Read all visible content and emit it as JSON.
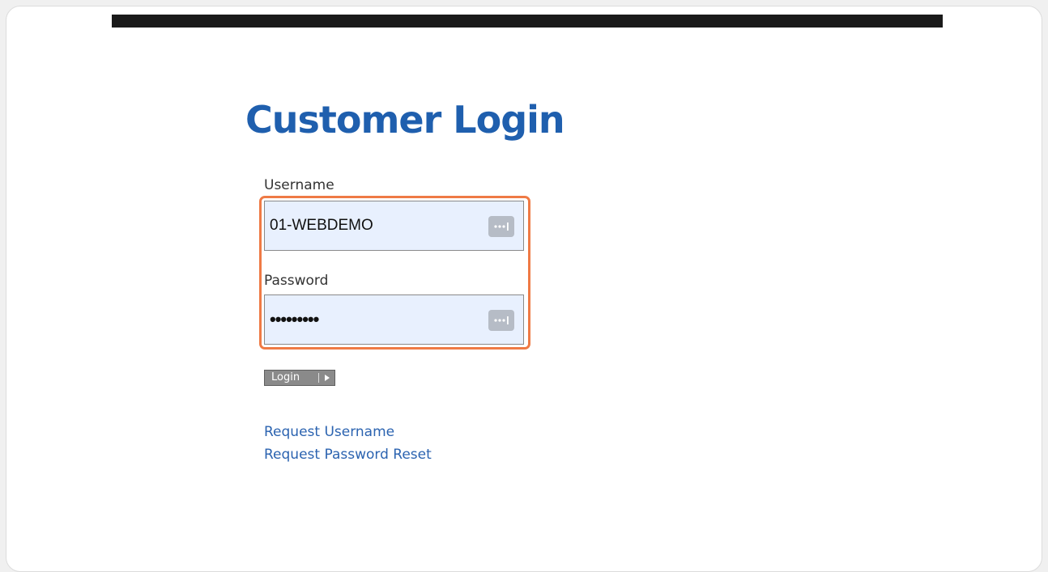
{
  "page": {
    "title": "Customer Login"
  },
  "form": {
    "username_label": "Username",
    "username_value": "01-WEBDEMO",
    "password_label": "Password",
    "password_value": "•••••••••",
    "login_label": "Login"
  },
  "links": {
    "request_username": "Request Username",
    "request_password_reset": "Request Password Reset"
  },
  "icons": {
    "autofill": "password-manager-icon",
    "login_arrow": "play-arrow-icon"
  },
  "colors": {
    "title": "#1f5fae",
    "link": "#2b63b0",
    "highlight": "#ef7a45",
    "input_background": "#e8f0fe",
    "top_bar": "#1a1a1a"
  }
}
